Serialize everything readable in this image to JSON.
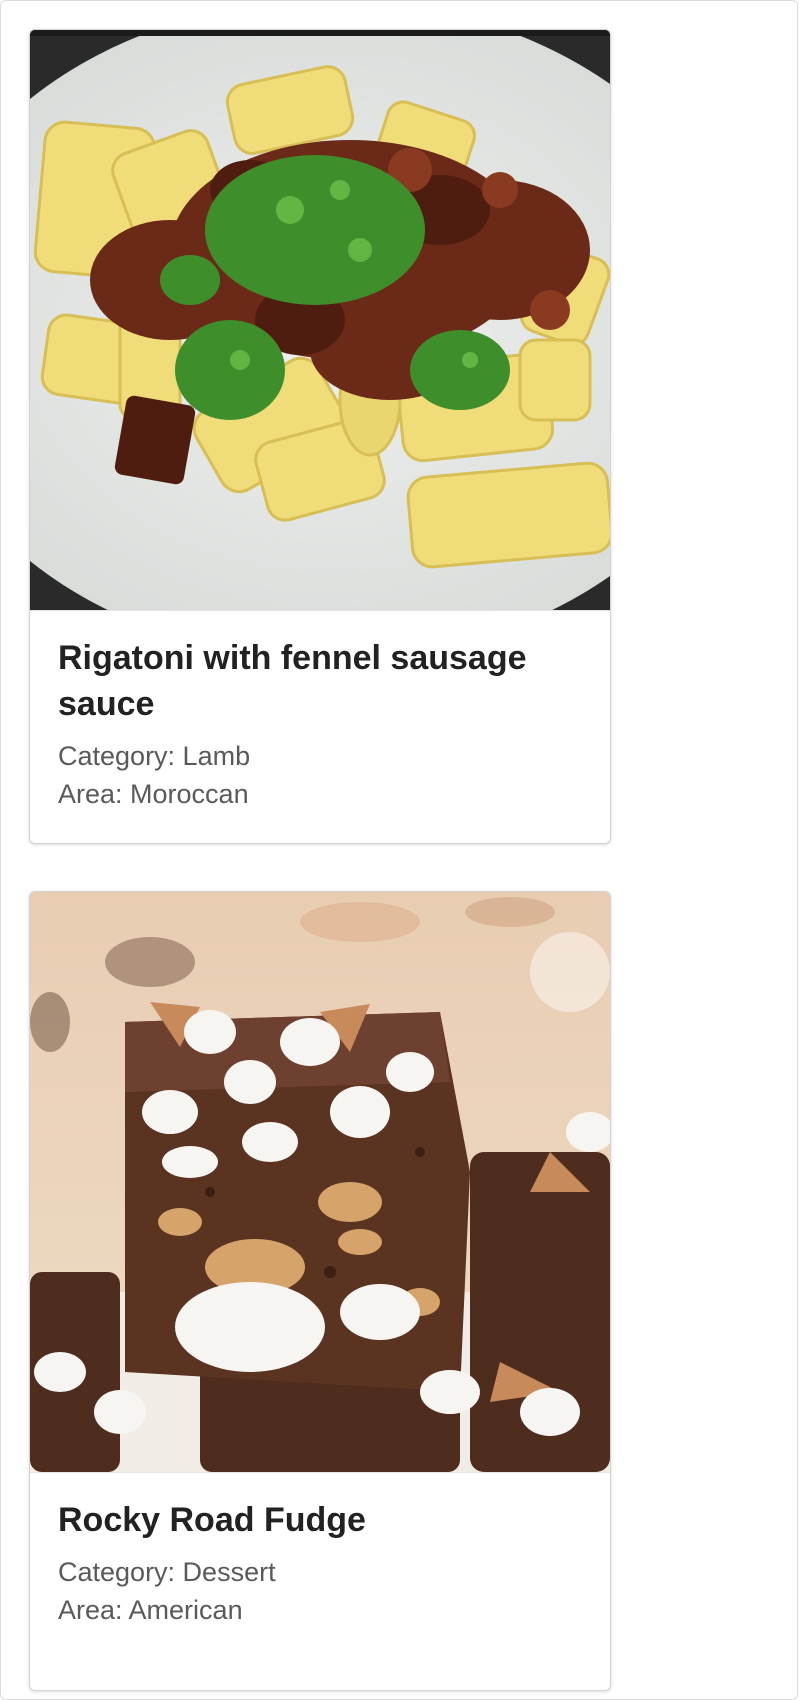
{
  "recipes": [
    {
      "title": "Rigatoni with fennel sausage sauce",
      "category": "Category: Lamb",
      "area": "Area: Moroccan",
      "image_alt": "rigatoni-pasta-photo"
    },
    {
      "title": "Rocky Road Fudge",
      "category": "Category: Dessert",
      "area": "Area: American",
      "image_alt": "rocky-road-fudge-photo"
    }
  ],
  "colors": {
    "title": "#222222",
    "meta": "#5a5a5a",
    "card_border": "#d4d4d5"
  }
}
